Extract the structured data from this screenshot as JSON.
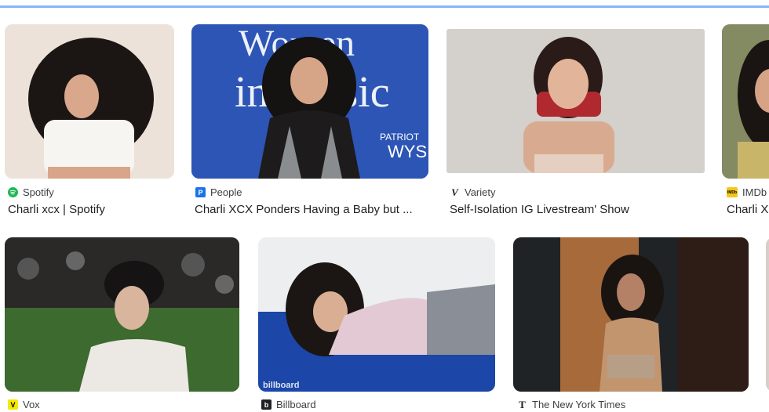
{
  "results_row1": [
    {
      "source": "Spotify",
      "caption": "Charli xcx | Spotify",
      "favicon": "spotify-icon",
      "favicon_color": "#1db954"
    },
    {
      "source": "People",
      "caption": "Charli XCX Ponders Having a Baby but ...",
      "favicon": "people-icon",
      "favicon_color": "#1a73e8",
      "image_text": [
        "Women",
        "in Music",
        "PATRIOT",
        "WYS"
      ]
    },
    {
      "source": "Variety",
      "caption": "Self-Isolation IG Livestream' Show",
      "favicon": "variety-icon",
      "favicon_color": "#202124"
    },
    {
      "source": "IMDb",
      "caption": "Charli X",
      "favicon": "imdb-icon",
      "favicon_color": "#f5c518"
    }
  ],
  "results_row2": [
    {
      "source": "Vox",
      "favicon": "vox-icon",
      "favicon_color": "#f5e900"
    },
    {
      "source": "Billboard",
      "favicon": "billboard-icon",
      "favicon_color": "#202124",
      "image_text": "billboard"
    },
    {
      "source": "The New York Times",
      "favicon": "nyt-icon",
      "favicon_color": "#202124"
    }
  ],
  "favicon_glyphs": {
    "people": "P",
    "variety": "V",
    "imdb": "IMDb",
    "vox": "V",
    "billboard": "b",
    "nyt": "T"
  },
  "accent_color": "#8ab4f8"
}
